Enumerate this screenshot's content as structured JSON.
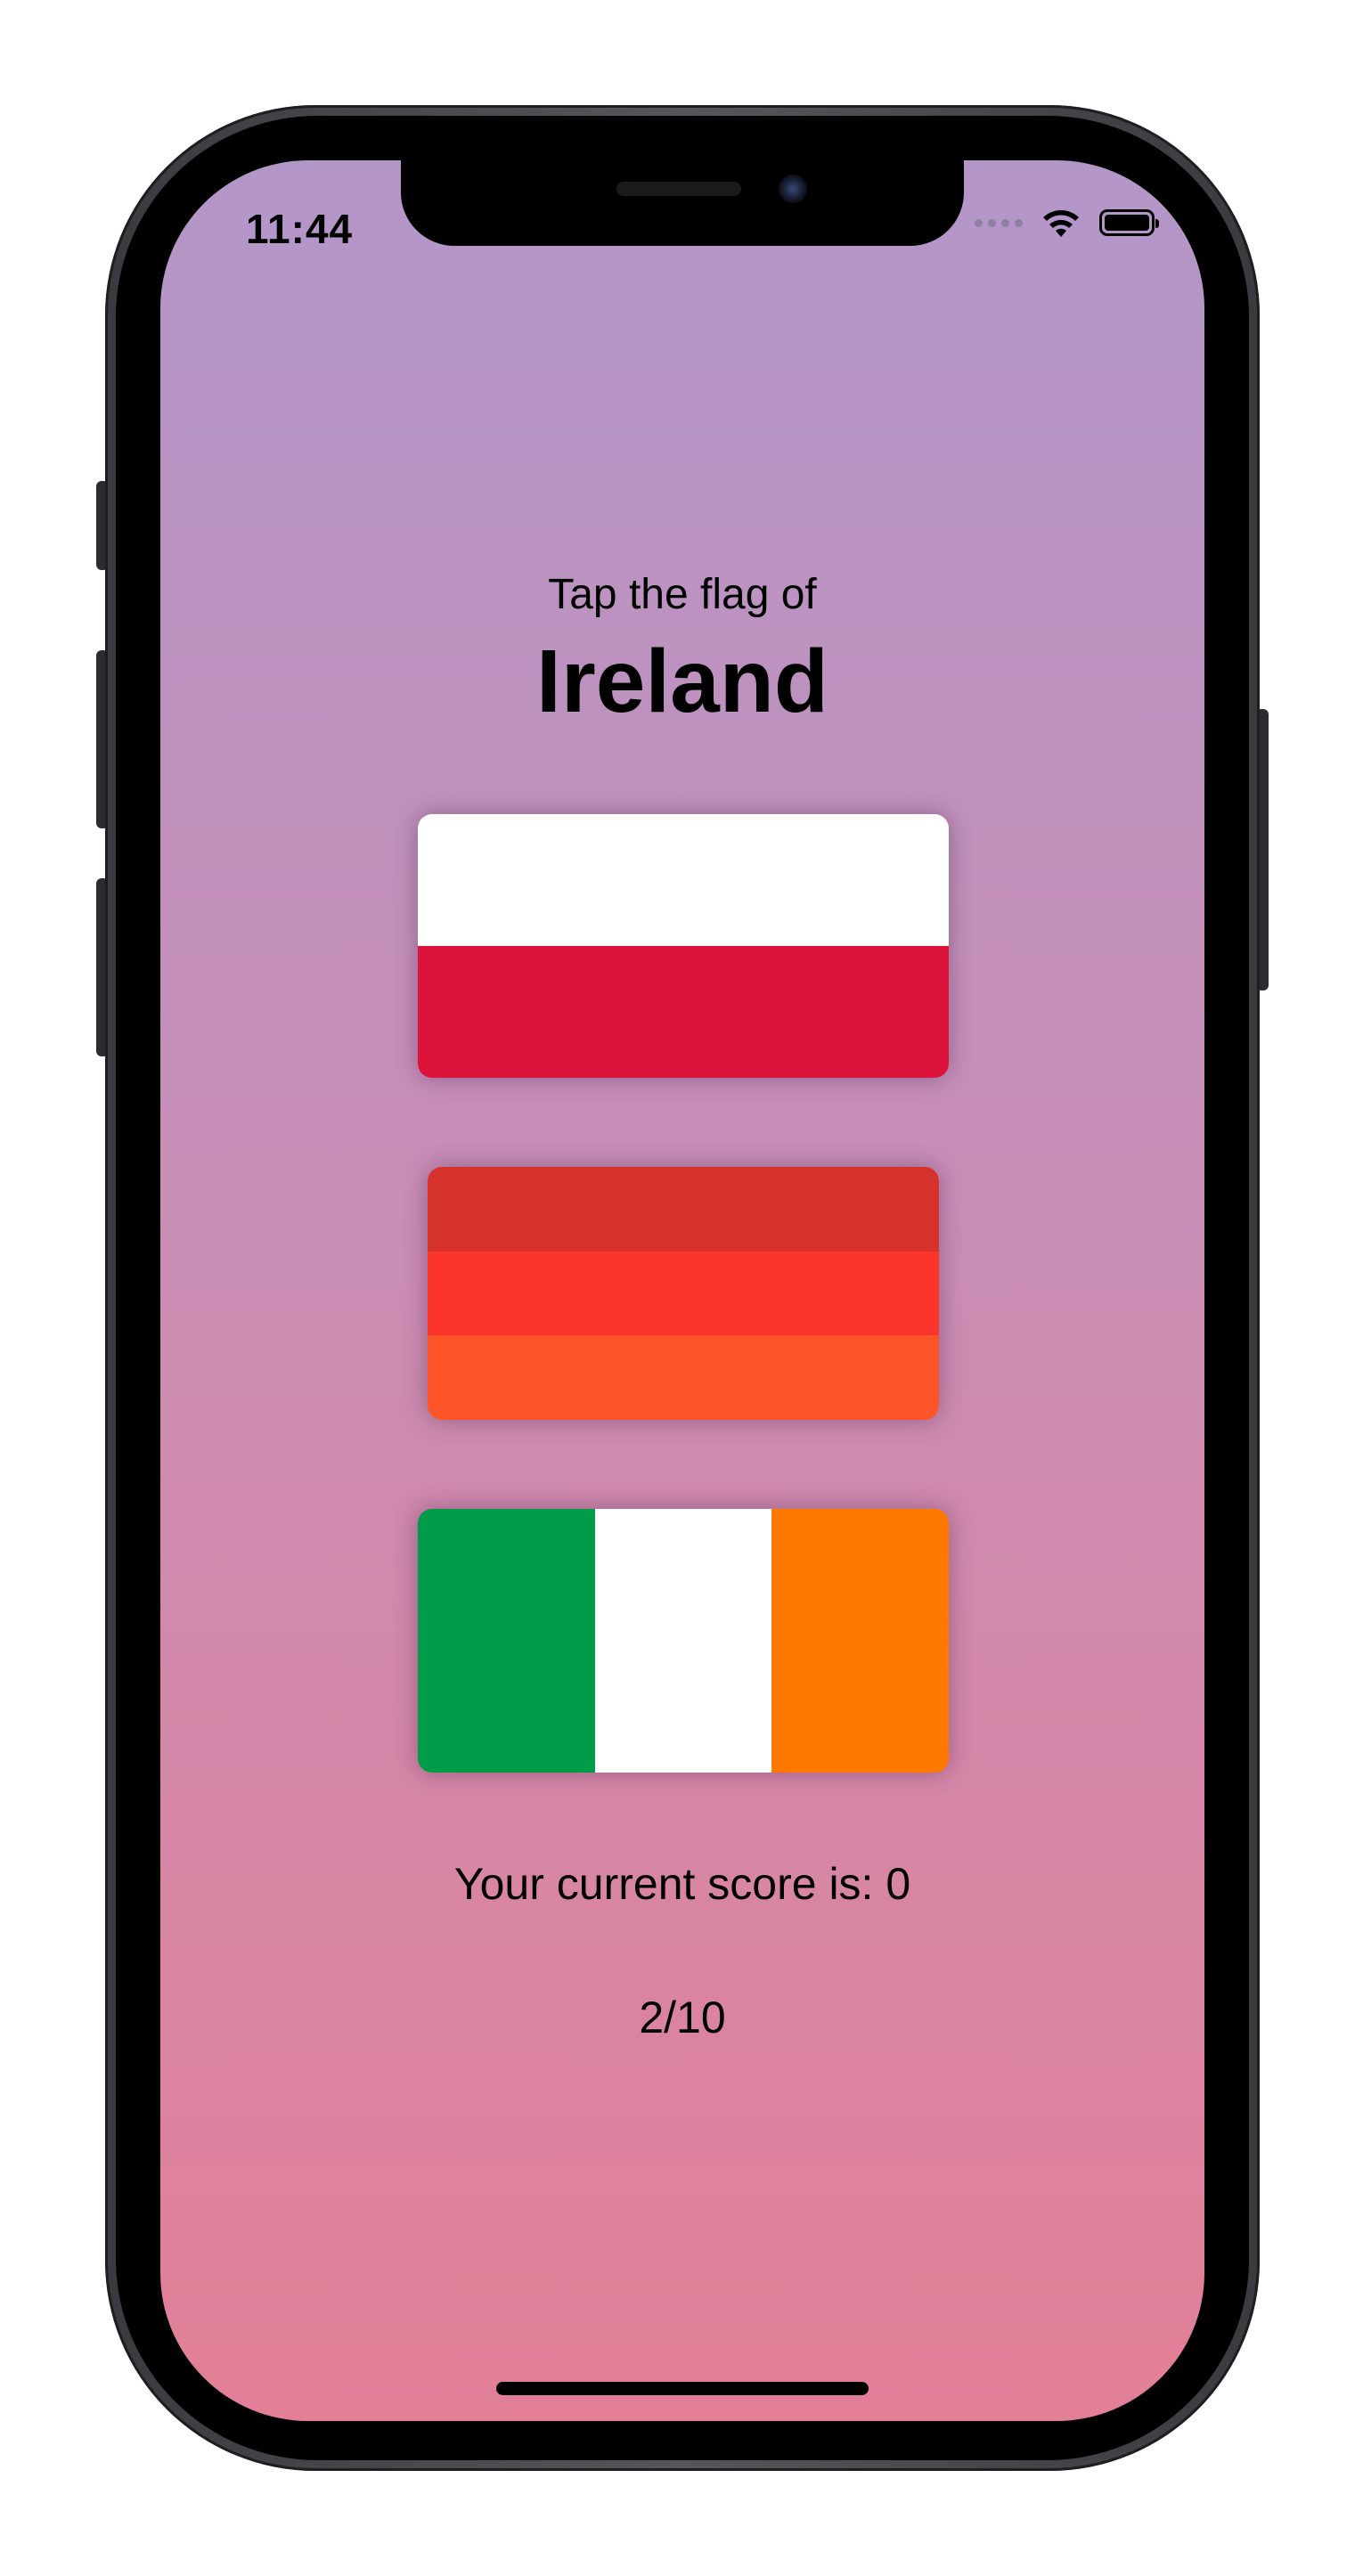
{
  "status_bar": {
    "time": "11:44",
    "wifi_icon": "wifi-icon",
    "battery_icon": "battery-icon",
    "battery_level": 1.0
  },
  "game": {
    "prompt": "Tap the flag of",
    "country": "Ireland",
    "flags": [
      {
        "name": "Poland",
        "orientation": "horizontal",
        "stripes": [
          "#ffffff",
          "#dc143c"
        ]
      },
      {
        "name": "Unknown red-orange tricolor",
        "orientation": "horizontal",
        "stripes": [
          "#d4322b",
          "#fb342c",
          "#fe5429"
        ]
      },
      {
        "name": "Ireland",
        "orientation": "vertical",
        "stripes": [
          "#009b48",
          "#ffffff",
          "#ff7900"
        ]
      }
    ],
    "score_text": "Your current score is: 0",
    "progress_text": "2/10"
  },
  "colors": {
    "background_top": "#b397c9",
    "background_bottom": "#e37f97",
    "text": "#000000"
  }
}
